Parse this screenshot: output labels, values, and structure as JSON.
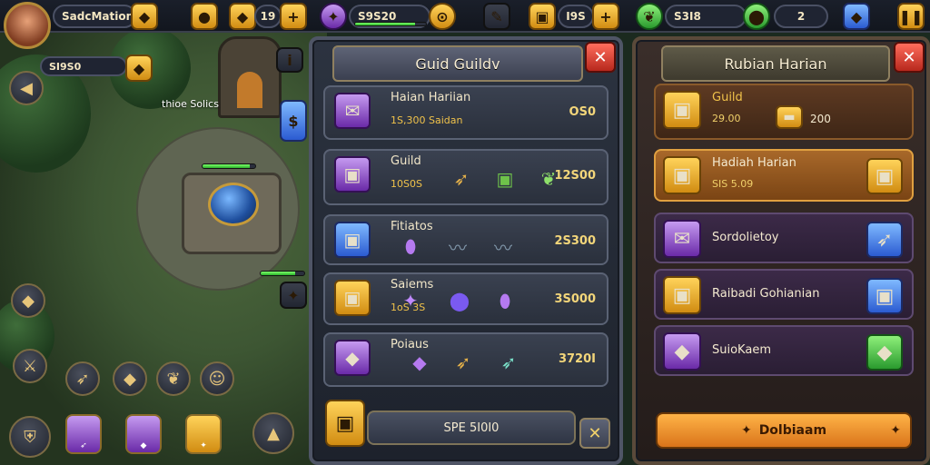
{
  "hud": {
    "player_name": "SadcMation",
    "player_gold": "",
    "resource_1": "19",
    "resource_2_label": "S9S20",
    "resource_3": "I9S",
    "resource_4": "S3I8",
    "resource_5": "2"
  },
  "world": {
    "player_tag_value": "SI9S0",
    "npc_label": "thioe Solics"
  },
  "guild_panel": {
    "title": "Guid Guildv",
    "close_icon": "✕",
    "rows": [
      {
        "title": "Haian Hariian",
        "sub": "1S,300 Saidan",
        "price": "OS0"
      },
      {
        "title": "Guild",
        "sub": "10S0S",
        "price": "12S00"
      },
      {
        "title": "Fitiatos",
        "sub": "",
        "price": "2S300"
      },
      {
        "title": "Saiems",
        "sub": "1oS 3S",
        "price": "3S000"
      },
      {
        "title": "Poiaus",
        "sub": "",
        "price": "3720I"
      }
    ],
    "footer_label": "SPE 5I0I0",
    "footer_close": "✕"
  },
  "reward_panel": {
    "title": "Rubian Harian",
    "close_icon": "✕",
    "rows": [
      {
        "title": "Guild",
        "sub": "29.00",
        "extra": "200"
      },
      {
        "title": "Hadiah Harian",
        "sub": "SIS 5.09",
        "extra": ""
      },
      {
        "title": "Sordolietoy",
        "sub": "",
        "extra": ""
      },
      {
        "title": "Raibadi Gohianian",
        "sub": "",
        "extra": ""
      },
      {
        "title": "SuioKaem",
        "sub": "",
        "extra": ""
      }
    ],
    "button_label": "Dolbiaam"
  },
  "colors": {
    "accent_gold": "#f0c24a",
    "close_red": "#c0281c",
    "panel_dark": "#1d222c",
    "reward_highlight": "#9a5a1a"
  }
}
